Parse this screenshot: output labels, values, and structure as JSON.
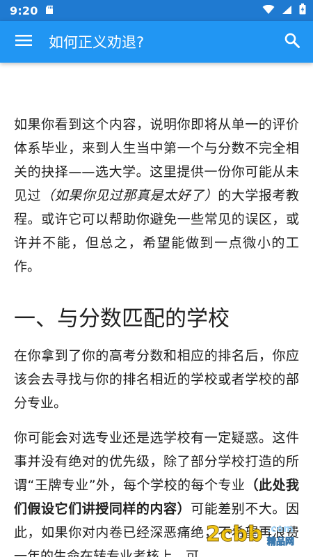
{
  "status_bar": {
    "time": "9:20",
    "icons": [
      "sd-card-icon",
      "wifi-icon",
      "signal-icon",
      "battery-icon"
    ]
  },
  "app_bar": {
    "title": "如何正义劝退?",
    "menu_icon": "hamburger-menu-icon",
    "search_icon": "search-icon",
    "color": "#2196f3"
  },
  "article": {
    "intro_before": "如果你看到这个内容，说明你即将从单一的评价体系毕业，来到人生当中第一个与分数不完全相关的抉择——选大学。这里提供一份你可能从未见过",
    "intro_italic": "（如果你见过那真是太好了）",
    "intro_after": "的大学报考教程。或许它可以帮助你避免一些常见的误区，或许并不能，但总之，希望能做到一点微小的工作。",
    "section1_title": "一、与分数匹配的学校",
    "section1_p1": "在你拿到了你的高考分数和相应的排名后，你应该会去寻找与你的排名相近的学校或者学校的部分专业。",
    "section1_p2_before": "你可能会对选专业还是选学校有一定疑惑。这件事并没有绝对的优先级，除了部分学校打造的所谓“王牌专业”外，每个学校的每个专业",
    "section1_p2_bold": "（此处我们假设它们讲授同样的内容）",
    "section1_p2_after": "可能差别不大。因此，如果你对内卷已经深恶痛绝，不希望再浪费一年的生命在转专业考核上，可"
  },
  "watermark": {
    "text": "2cbb.com 精品网"
  }
}
